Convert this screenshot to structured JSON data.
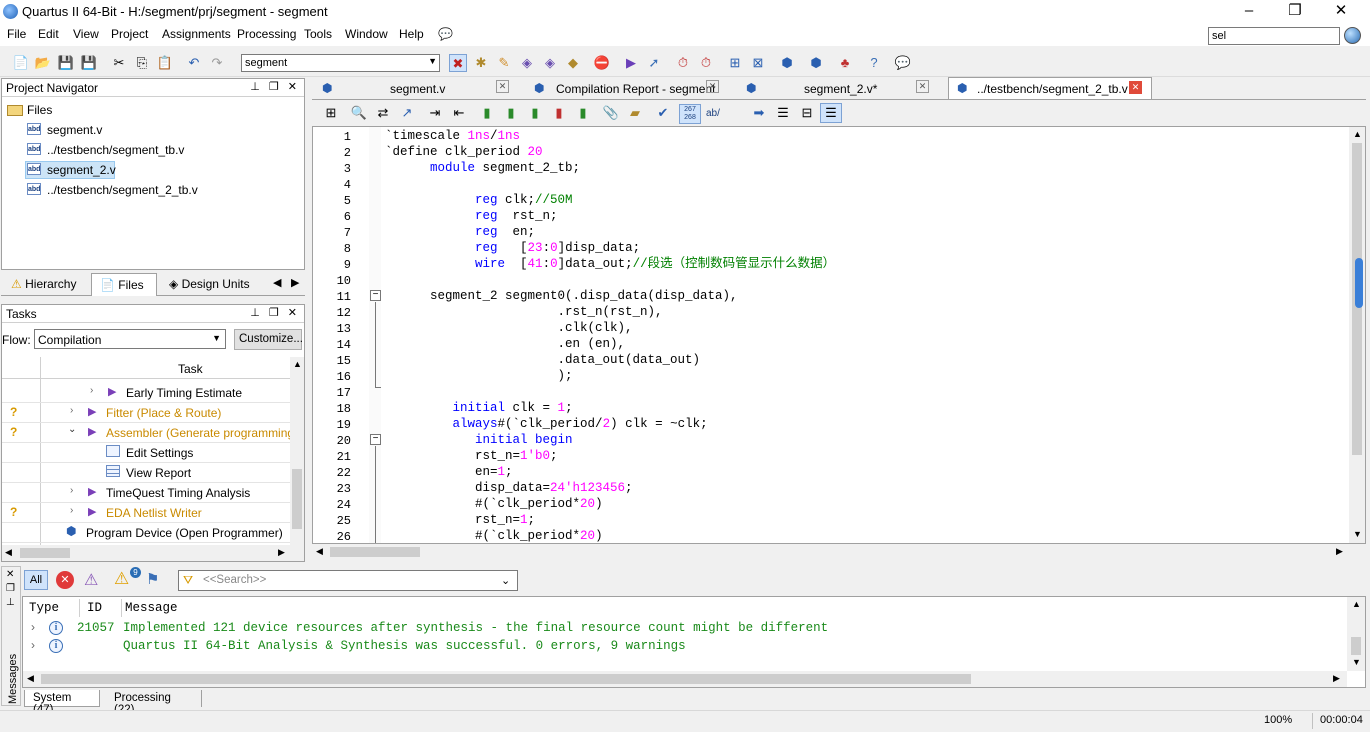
{
  "window": {
    "title": "Quartus II 64-Bit - H:/segment/prj/segment - segment",
    "minimize": "–",
    "maximize": "❐",
    "close": "✕"
  },
  "menu": [
    "File",
    "Edit",
    "View",
    "Project",
    "Assignments",
    "Processing",
    "Tools",
    "Window",
    "Help"
  ],
  "search": {
    "value": "sel"
  },
  "toolbar": {
    "entity_select": "segment"
  },
  "project_navigator": {
    "title": "Project Navigator",
    "root": "Files",
    "files": [
      "segment.v",
      "../testbench/segment_tb.v",
      "segment_2.v",
      "../testbench/segment_2_tb.v"
    ],
    "selected_index": 2,
    "file_icon_text": "abd",
    "tabs": [
      "Hierarchy",
      "Files",
      "Design Units"
    ]
  },
  "tasks": {
    "title": "Tasks",
    "flow_label": "Flow:",
    "flow_value": "Compilation",
    "customize": "Customize...",
    "column": "Task",
    "rows": [
      {
        "status": "",
        "label": "Early Timing Estimate",
        "color": "#000000"
      },
      {
        "status": "?",
        "label": "Fitter (Place & Route)",
        "color": "#c98a00"
      },
      {
        "status": "?",
        "label": "Assembler (Generate programming file",
        "color": "#c98a00"
      },
      {
        "status": "",
        "label": "Edit Settings",
        "color": "#000000"
      },
      {
        "status": "",
        "label": "View Report",
        "color": "#000000"
      },
      {
        "status": "",
        "label": "TimeQuest Timing Analysis",
        "color": "#000000"
      },
      {
        "status": "?",
        "label": "EDA Netlist Writer",
        "color": "#c98a00"
      },
      {
        "status": "",
        "label": "Program Device (Open Programmer)",
        "color": "#000000"
      }
    ]
  },
  "editor_tabs": [
    {
      "label": "segment.v"
    },
    {
      "label": "Compilation Report - segment"
    },
    {
      "label": "segment_2.v*"
    },
    {
      "label": "../testbench/segment_2_tb.v"
    }
  ],
  "editor_toolbar": {
    "line_badge": "267\n268",
    "ab_label": "ab/"
  },
  "code_lines": [
    {
      "n": "1",
      "t": "`timescale 1ns/1ns"
    },
    {
      "n": "2",
      "t": "`define clk_period 20"
    },
    {
      "n": "3",
      "t": "      module segment_2_tb;"
    },
    {
      "n": "4",
      "t": ""
    },
    {
      "n": "5",
      "t": "            reg clk;//50M"
    },
    {
      "n": "6",
      "t": "            reg  rst_n;"
    },
    {
      "n": "7",
      "t": "            reg  en;"
    },
    {
      "n": "8",
      "t": "            reg   [23:0]disp_data;"
    },
    {
      "n": "9",
      "t": "            wire  [41:0]data_out;//段选（控制数码管显示什么数据）"
    },
    {
      "n": "10",
      "t": ""
    },
    {
      "n": "11",
      "t": "      segment_2 segment0(.disp_data(disp_data),"
    },
    {
      "n": "12",
      "t": "                       .rst_n(rst_n),"
    },
    {
      "n": "13",
      "t": "                       .clk(clk),"
    },
    {
      "n": "14",
      "t": "                       .en (en),"
    },
    {
      "n": "15",
      "t": "                       .data_out(data_out)"
    },
    {
      "n": "16",
      "t": "                       );"
    },
    {
      "n": "17",
      "t": ""
    },
    {
      "n": "18",
      "t": "         initial clk = 1;"
    },
    {
      "n": "19",
      "t": "         always#(`clk_period/2) clk = ~clk;"
    },
    {
      "n": "20",
      "t": "            initial begin"
    },
    {
      "n": "21",
      "t": "            rst_n=1'b0;"
    },
    {
      "n": "22",
      "t": "            en=1;"
    },
    {
      "n": "23",
      "t": "            disp_data=24'h123456;"
    },
    {
      "n": "24",
      "t": "            #(`clk_period*20)"
    },
    {
      "n": "25",
      "t": "            rst_n=1;"
    },
    {
      "n": "26",
      "t": "            #(`clk_period*20)"
    }
  ],
  "messages": {
    "filter_all": "All",
    "warning_badge": "9",
    "search_placeholder": "<<Search>>",
    "columns": [
      "Type",
      "ID",
      "Message"
    ],
    "rows": [
      {
        "id": "21057",
        "text": "Implemented 121 device resources after synthesis - the final resource count might be different"
      },
      {
        "id": "",
        "text": "Quartus II 64-Bit Analysis & Synthesis was successful. 0 errors, 9 warnings"
      }
    ],
    "side_label": "Messages",
    "tabs": [
      "System (47)",
      "Processing (22)"
    ]
  },
  "status": {
    "zoom": "100%",
    "time": "00:00:04"
  }
}
